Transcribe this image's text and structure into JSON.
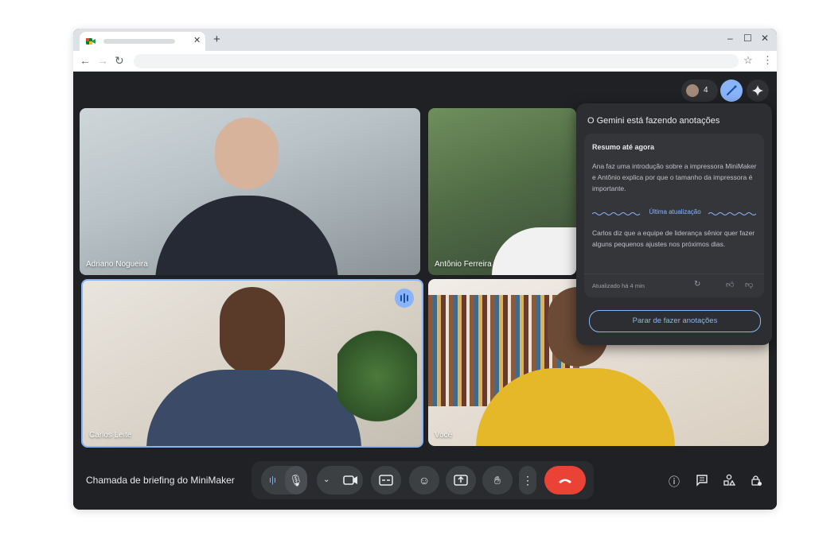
{
  "browser": {
    "new_tab": "+",
    "tab_close": "✕",
    "minimize": "–",
    "maximize": "☐",
    "close": "✕"
  },
  "meet": {
    "participant_count": "4",
    "meeting_title": "Chamada de briefing do MiniMaker",
    "tiles": [
      {
        "name": "Adriano Nogueira"
      },
      {
        "name": "Antônio Ferreira"
      },
      {
        "name": "Carlos Leite"
      },
      {
        "name": "Você"
      }
    ]
  },
  "gemini": {
    "title": "O Gemini está fazendo anotações",
    "summary_heading": "Resumo até agora",
    "summary_text": "Ana faz uma introdução sobre a impressora MiniMaker e Antônio explica por que o tamanho da impressora é importante.",
    "divider_label": "Última atualização",
    "update_text": "Carlos diz que a equipe de liderança sênior quer fazer alguns pequenos ajustes nos próximos dias.",
    "updated_time": "Atualizado há 4 min",
    "stop_button": "Parar de fazer anotações"
  },
  "colors": {
    "accent": "#8ab4f8",
    "end_call": "#ea4335",
    "bg": "#202124"
  }
}
